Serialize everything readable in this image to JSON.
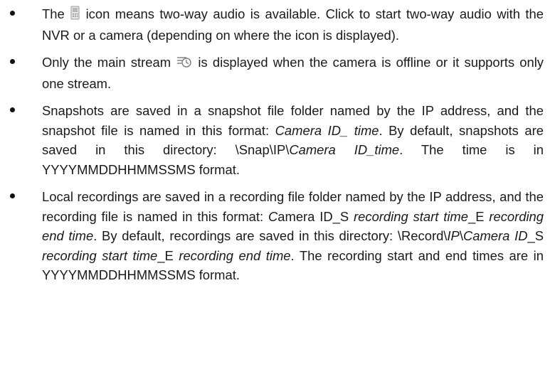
{
  "bullets": [
    {
      "before_icon": "The ",
      "icon": "two-way-audio-icon",
      "after_icon": " icon means two-way audio is available. Click to start two-way audio with the NVR or a camera (depending on where the icon is displayed)."
    },
    {
      "before_icon": "Only the main stream ",
      "icon": "main-stream-icon",
      "after_icon": " is displayed when the camera is offline or it supports only one stream."
    },
    {
      "p1": "Snapshots are saved in a snapshot file folder named by the IP address, and the snapshot file is named in this format: ",
      "p2": "Camera ID_ time",
      "p3": ". By default, snapshots are saved in this directory: \\Snap\\IP\\",
      "p4": "Camera ID_time",
      "p5": ". The time is in YYYYMMDDHHMMSSMS format."
    },
    {
      "p1": "Local recordings are saved in a recording file folder named by the IP address, and the recording file is named in this format: ",
      "p2": "C",
      "p3": "amera ID_S ",
      "p4": "recording start time",
      "p5": "_E ",
      "p6": "recording end time",
      "p7": ". By default, recordings are saved in this directory: \\Record\\",
      "p8": "IP",
      "p9": "\\",
      "p10": "Camera ID",
      "p11": "_S ",
      "p12": "recording start time",
      "p13": "_E ",
      "p14": "recording end time",
      "p15": ". The recording start and end times are in YYYYMMDDHHMMSSMS format."
    }
  ]
}
